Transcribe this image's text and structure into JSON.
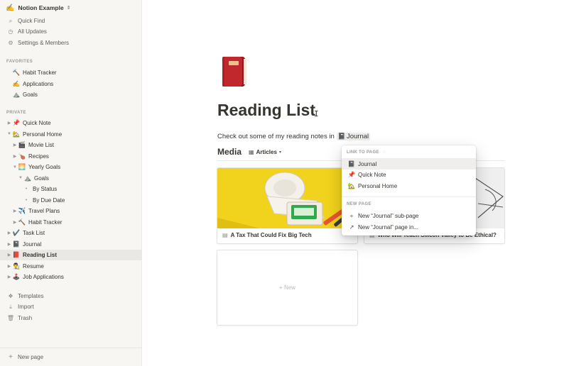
{
  "workspace": {
    "emoji": "✍️",
    "name": "Notion Example",
    "switch_icon": "⇕"
  },
  "top_nav": [
    {
      "icon": "search-icon",
      "glyph": "⌕",
      "label": "Quick Find"
    },
    {
      "icon": "clock-icon",
      "glyph": "◷",
      "label": "All Updates"
    },
    {
      "icon": "gear-icon",
      "glyph": "⚙",
      "label": "Settings & Members"
    }
  ],
  "favorites_label": "FAVORITES",
  "favorites": [
    {
      "emoji": "🔨",
      "label": "Habit Tracker"
    },
    {
      "emoji": "✍️",
      "label": "Applications"
    },
    {
      "emoji": "⛰️",
      "label": "Goals"
    }
  ],
  "private_label": "PRIVATE",
  "private": [
    {
      "emoji": "📌",
      "label": "Quick Note",
      "depth": 0,
      "caret": "▶"
    },
    {
      "emoji": "🏡",
      "label": "Personal Home",
      "depth": 0,
      "caret": "▼"
    },
    {
      "emoji": "🎬",
      "label": "Movie List",
      "depth": 1,
      "caret": "▶"
    },
    {
      "emoji": "🍗",
      "label": "Recipes",
      "depth": 1,
      "caret": "▶"
    },
    {
      "emoji": "🌅",
      "label": "Yearly Goals",
      "depth": 1,
      "caret": "▼"
    },
    {
      "emoji": "⛰️",
      "label": "Goals",
      "depth": 2,
      "caret": "▼"
    },
    {
      "emoji": "",
      "label": "By Status",
      "depth": 3,
      "caret": "•"
    },
    {
      "emoji": "",
      "label": "By Due Date",
      "depth": 3,
      "caret": "•"
    },
    {
      "emoji": "✈️",
      "label": "Travel Plans",
      "depth": 1,
      "caret": "▶"
    },
    {
      "emoji": "🔨",
      "label": "Habit Tracker",
      "depth": 1,
      "caret": "▶"
    },
    {
      "emoji": "✔️",
      "label": "Task List",
      "depth": 0,
      "caret": "▶"
    },
    {
      "emoji": "📓",
      "label": "Journal",
      "depth": 0,
      "caret": "▶"
    },
    {
      "emoji": "📕",
      "label": "Reading List",
      "depth": 0,
      "caret": "▶",
      "selected": true
    },
    {
      "emoji": "👨‍🎨",
      "label": "Resume",
      "depth": 0,
      "caret": "▶"
    },
    {
      "emoji": "🕹️",
      "label": "Job Applications",
      "depth": 0,
      "caret": "▶"
    }
  ],
  "bottom_nav": [
    {
      "icon": "templates-icon",
      "glyph": "❖",
      "label": "Templates"
    },
    {
      "icon": "import-icon",
      "glyph": "⤓",
      "label": "Import"
    },
    {
      "icon": "trash-icon",
      "glyph": "🗑",
      "label": "Trash"
    }
  ],
  "new_page": {
    "glyph": "+",
    "label": "New page"
  },
  "page": {
    "title": "Reading List",
    "intro": "Check out some of my reading notes in",
    "inline_link_emoji": "📓",
    "inline_link_text": "Journal"
  },
  "media": {
    "title": "Media",
    "view_icon": "▦",
    "view_name": "Articles",
    "view_caret": "▾",
    "cards": [
      {
        "title": "A Tax That Could Fix Big Tech",
        "icon": "▤"
      },
      {
        "title": "Who Will Teach Silicon Valley to Be Ethical?",
        "icon": "▤"
      }
    ],
    "new_label": "+  New"
  },
  "popup": {
    "link_label": "LINK TO PAGE",
    "spinner": "◌",
    "links": [
      {
        "emoji": "📓",
        "label": "Journal"
      },
      {
        "emoji": "📌",
        "label": "Quick Note"
      },
      {
        "emoji": "🏡",
        "label": "Personal Home"
      }
    ],
    "new_label": "NEW PAGE",
    "new_items": [
      {
        "glyph": "+",
        "label": "New “Journal” sub-page"
      },
      {
        "glyph": "↗",
        "label": "New “Journal” page in..."
      }
    ]
  }
}
